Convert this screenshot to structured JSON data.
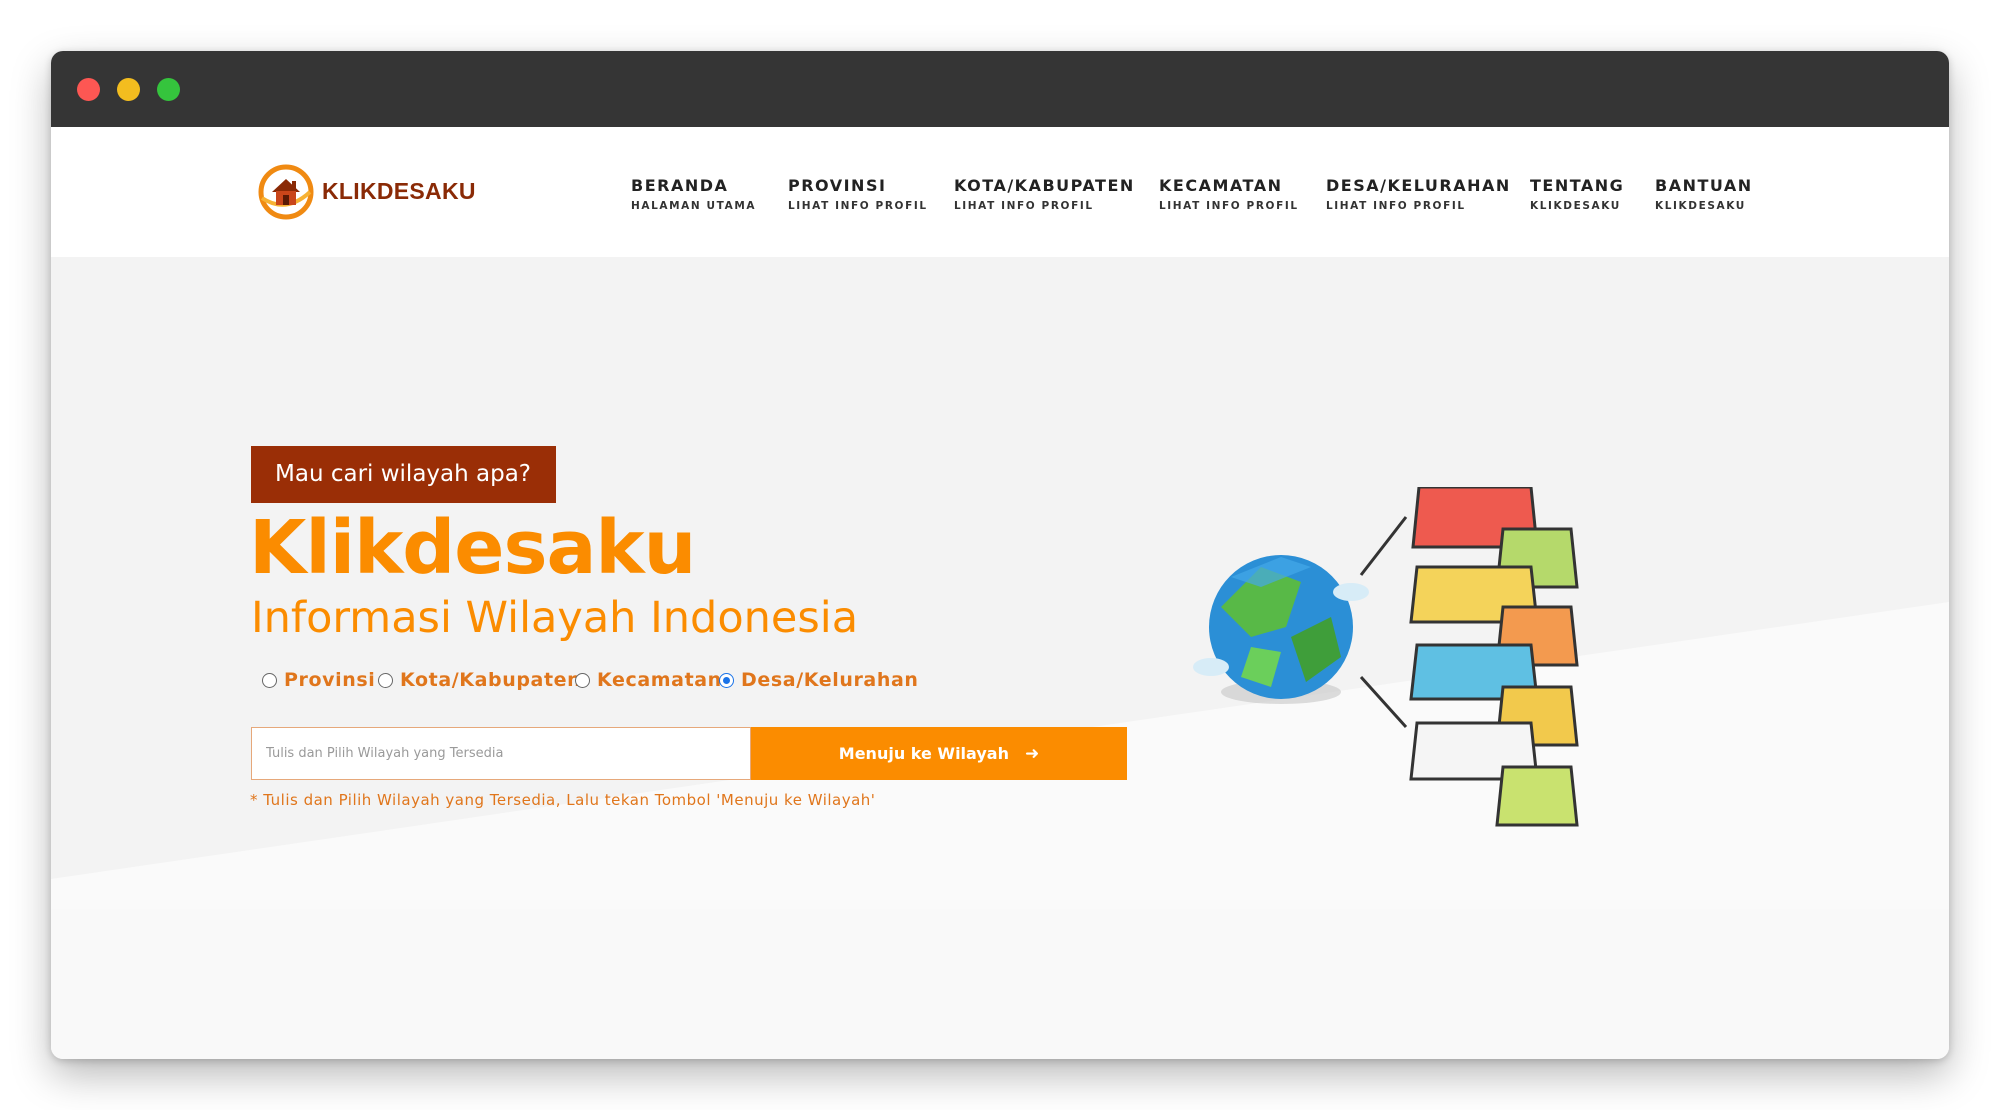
{
  "brand": {
    "name": "KLIKDESAKU"
  },
  "nav": {
    "items": [
      {
        "label": "BERANDA",
        "sub": "HALAMAN UTAMA"
      },
      {
        "label": "PROVINSI",
        "sub": "LIHAT INFO PROFIL"
      },
      {
        "label": "KOTA/KABUPATEN",
        "sub": "LIHAT INFO PROFIL"
      },
      {
        "label": "KECAMATAN",
        "sub": "LIHAT INFO PROFIL"
      },
      {
        "label": "DESA/KELURAHAN",
        "sub": "LIHAT INFO PROFIL"
      },
      {
        "label": "TENTANG",
        "sub": "KLIKDESAKU"
      },
      {
        "label": "BANTUAN",
        "sub": "KLIKDESAKU"
      }
    ]
  },
  "hero": {
    "badge": "Mau cari wilayah apa?",
    "title": "Klikdesaku",
    "subtitle": "Informasi Wilayah Indonesia",
    "radio_options": [
      {
        "label": "Provinsi",
        "checked": false
      },
      {
        "label": "Kota/Kabupaten",
        "checked": false
      },
      {
        "label": "Kecamatan",
        "checked": false
      },
      {
        "label": "Desa/Kelurahan",
        "checked": true
      }
    ],
    "search": {
      "value": "",
      "placeholder": "Tulis dan Pilih Wilayah yang Tersedia",
      "button_label": "Menuju ke Wilayah",
      "button_icon": "arrow-right-icon"
    },
    "hint": "* Tulis dan Pilih Wilayah yang Tersedia, Lalu tekan Tombol 'Menuju ke Wilayah'"
  },
  "colors": {
    "accent": "#fb8c00",
    "badge": "#9a2e06",
    "brand_text": "#8a2a06",
    "titlebar": "#353535"
  }
}
